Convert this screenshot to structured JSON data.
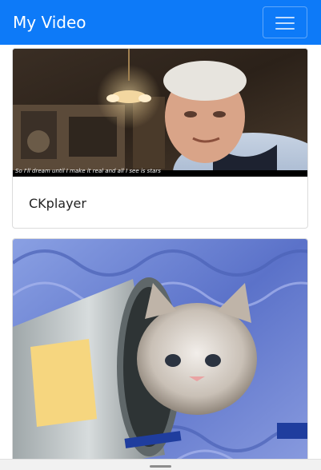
{
  "navbar": {
    "brand": "My Video",
    "menu_icon": "hamburger-menu-icon",
    "color": "#0d7af8"
  },
  "videos": [
    {
      "title": "CKplayer",
      "subtitle": "So I'll dream until I make it real and all I see is stars"
    }
  ]
}
